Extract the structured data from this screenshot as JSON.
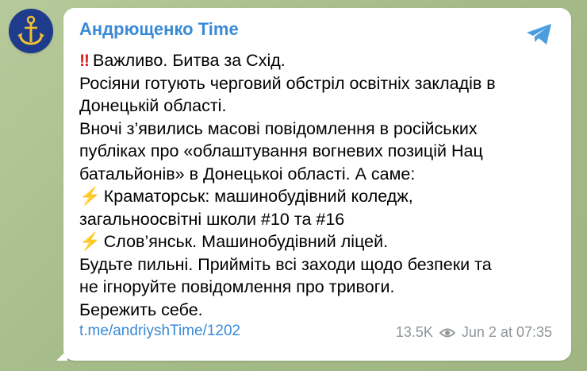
{
  "channel": {
    "name": "Андрющенко Time"
  },
  "message": {
    "lines": [
      {
        "icon": "double-exclamation",
        "text": "Важливо. Битва за Схід."
      },
      {
        "text": "Росіяни готують черговий обстріл освітніх закладів в"
      },
      {
        "text": "Донецькій області."
      },
      {
        "text": "Вночі з’явились масові повідомлення в російських"
      },
      {
        "text": "публіках про «облаштування вогневих позицій Нац"
      },
      {
        "text": "батальйонів» в Донецькоі області. А саме:"
      },
      {
        "icon": "lightning",
        "text": "Краматорськ: машинобудівний коледж,"
      },
      {
        "text": "загальноосвітні школи #10 та #16"
      },
      {
        "icon": "lightning",
        "text": "Слов’янськ. Машинобудівний ліцей."
      },
      {
        "text": "Будьте пильні. Прийміть всі заходи щодо безпеки та"
      },
      {
        "text": "не ігноруйте повідомлення про тривоги."
      },
      {
        "text": "Бережить себе."
      }
    ]
  },
  "footer": {
    "link": "t.me/andriyshTime/1202",
    "views": "13.5K",
    "date": "Jun 2 at 07:35"
  },
  "colors": {
    "accent": "#3a8ad6",
    "muted": "#8f9599",
    "bubble": "#ffffff",
    "avatar": "#1f3b8c"
  }
}
